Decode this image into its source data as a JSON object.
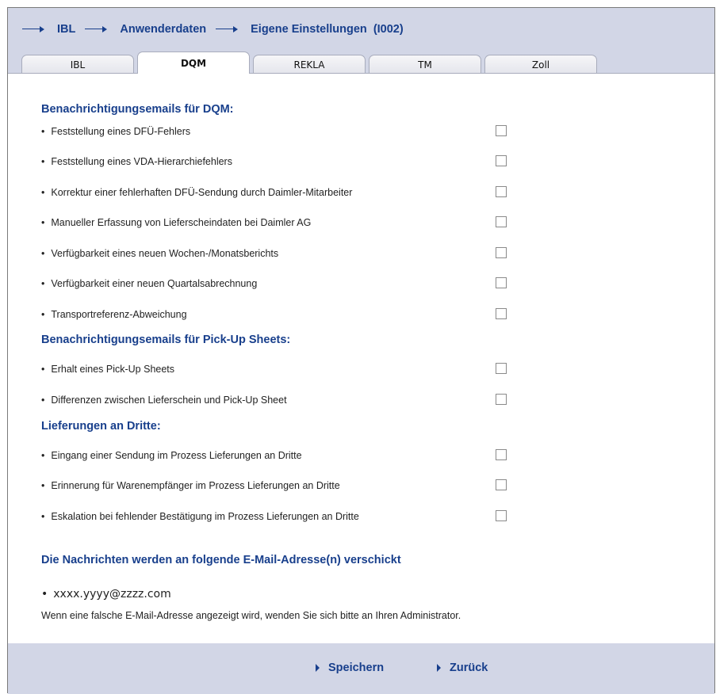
{
  "breadcrumb": {
    "items": [
      "IBL",
      "Anwenderdaten",
      "Eigene Einstellungen  (I002)"
    ]
  },
  "tabs": {
    "items": [
      "IBL",
      "DQM",
      "REKLA",
      "TM",
      "Zoll"
    ],
    "active": "DQM"
  },
  "sections": {
    "dqm": {
      "title": "Benachrichtigungsemails für DQM:",
      "items": [
        "Feststellung eines DFÜ-Fehlers",
        "Feststellung eines VDA-Hierarchiefehlers",
        "Korrektur einer fehlerhaften DFÜ-Sendung durch Daimler-Mitarbeiter",
        "Manueller Erfassung von Lieferscheindaten bei Daimler AG",
        "Verfügbarkeit eines neuen Wochen-/Monatsberichts",
        "Verfügbarkeit einer neuen Quartalsabrechnung",
        "Transportreferenz-Abweichung"
      ]
    },
    "pickup": {
      "title": "Benachrichtigungsemails für Pick-Up Sheets:",
      "items": [
        "Erhalt eines Pick-Up Sheets",
        "Differenzen zwischen Lieferschein und Pick-Up Sheet"
      ]
    },
    "dritte": {
      "title": "Lieferungen an Dritte:",
      "items": [
        "Eingang einer Sendung im Prozess Lieferungen an Dritte",
        "Erinnerung für Warenempfänger im Prozess Lieferungen an Dritte",
        "Eskalation bei fehlender Bestätigung im Prozess Lieferungen an Dritte"
      ]
    }
  },
  "email_info": {
    "title": "Die Nachrichten werden an folgende E-Mail-Adresse(n) verschickt",
    "address": "xxxx.yyyy@zzzz.com",
    "note": "Wenn eine falsche E-Mail-Adresse angezeigt wird, wenden Sie sich bitte an Ihren Administrator."
  },
  "footer": {
    "save_label": "Speichern",
    "back_label": "Zurück"
  },
  "colors": {
    "accent": "#183f8c",
    "header_bg": "#d2d6e6"
  }
}
